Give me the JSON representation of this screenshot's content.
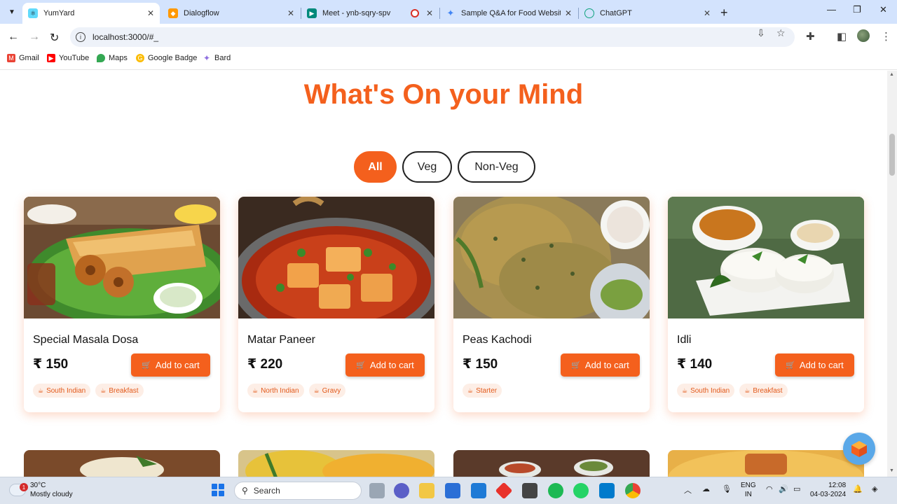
{
  "browser": {
    "tabs": [
      {
        "title": "YumYard",
        "active": true
      },
      {
        "title": "Dialogflow",
        "active": false
      },
      {
        "title": "Meet - ynb-sqry-spv",
        "active": false
      },
      {
        "title": "Sample Q&A for Food Website",
        "active": false
      },
      {
        "title": "ChatGPT",
        "active": false
      }
    ],
    "url": "localhost:3000/#_",
    "bookmarks": [
      "Gmail",
      "YouTube",
      "Maps",
      "Google Badge",
      "Bard"
    ]
  },
  "page": {
    "heading": "What's On your Mind",
    "filters": [
      "All",
      "Veg",
      "Non-Veg"
    ],
    "active_filter": "All",
    "cart_label": "Add to cart",
    "items": [
      {
        "name": "Special Masala Dosa",
        "price": "₹ 150",
        "tags": [
          "South Indian",
          "Breakfast"
        ]
      },
      {
        "name": "Matar Paneer",
        "price": "₹ 220",
        "tags": [
          "North Indian",
          "Gravy"
        ]
      },
      {
        "name": "Peas Kachodi",
        "price": "₹ 150",
        "tags": [
          "Starter"
        ]
      },
      {
        "name": "Idli",
        "price": "₹ 140",
        "tags": [
          "South Indian",
          "Breakfast"
        ]
      }
    ]
  },
  "taskbar": {
    "weather_temp": "30°C",
    "weather_desc": "Mostly cloudy",
    "weather_badge": "1",
    "search_label": "Search",
    "lang_line1": "ENG",
    "lang_line2": "IN",
    "time": "12:08",
    "date": "04-03-2024"
  },
  "colors": {
    "accent": "#f4601d",
    "tab_bar": "#d3e3fd"
  }
}
